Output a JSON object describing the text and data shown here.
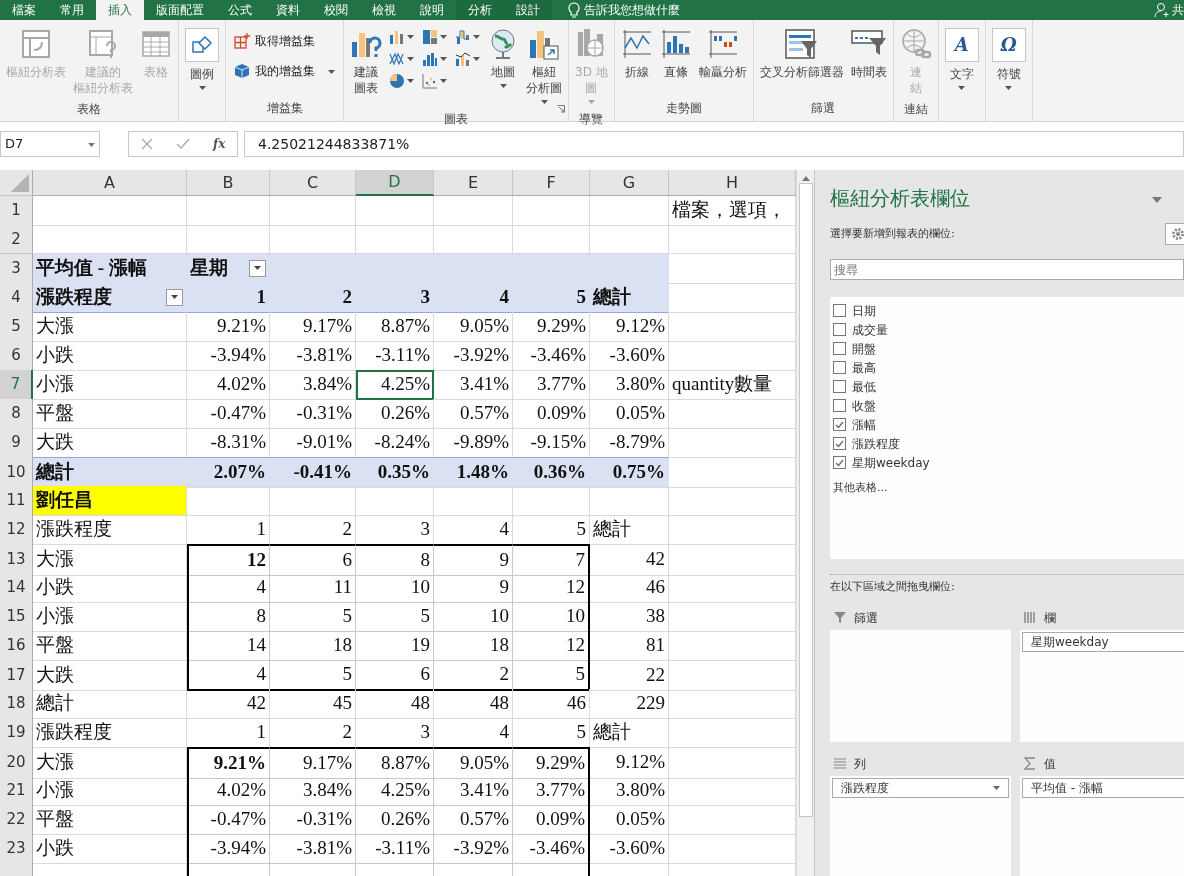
{
  "ribbon_tabs": [
    {
      "label": "檔案",
      "selected": false,
      "kind": "normal"
    },
    {
      "label": "常用",
      "selected": false,
      "kind": "normal"
    },
    {
      "label": "插入",
      "selected": true,
      "kind": "normal"
    },
    {
      "label": "版面配置",
      "selected": false,
      "kind": "normal"
    },
    {
      "label": "公式",
      "selected": false,
      "kind": "normal"
    },
    {
      "label": "資料",
      "selected": false,
      "kind": "normal"
    },
    {
      "label": "校閱",
      "selected": false,
      "kind": "normal"
    },
    {
      "label": "檢視",
      "selected": false,
      "kind": "normal"
    },
    {
      "label": "說明",
      "selected": false,
      "kind": "normal"
    },
    {
      "label": "分析",
      "selected": false,
      "kind": "contextual"
    },
    {
      "label": "設計",
      "selected": false,
      "kind": "contextual"
    }
  ],
  "tell_me": "告訴我您想做什麼",
  "share": "共",
  "ribbon_groups": [
    {
      "label": "表格",
      "items": [
        {
          "kind": "large",
          "lines": [
            "樞紐分析表"
          ],
          "disabled": true,
          "dropdown": false
        },
        {
          "kind": "large",
          "lines": [
            "建議的",
            "樞紐分析表"
          ],
          "disabled": true,
          "dropdown": false
        },
        {
          "kind": "large",
          "lines": [
            "表格"
          ],
          "disabled": true,
          "dropdown": false
        }
      ]
    },
    {
      "items": [
        {
          "kind": "framed",
          "lines": [
            "圖例"
          ],
          "disabled": false,
          "dropdown": true
        }
      ]
    },
    {
      "label": "增益集",
      "items": [
        {
          "kind": "small",
          "lines": [
            "取得增益集"
          ],
          "disabled": false,
          "dropdown": false
        },
        {
          "kind": "small",
          "lines": [
            "我的增益集"
          ],
          "disabled": false,
          "dropdown": true
        }
      ]
    },
    {
      "label": "圖表",
      "launcher": true,
      "items": [
        {
          "kind": "large",
          "lines": [
            "建議",
            "圖表"
          ],
          "disabled": false,
          "dropdown": false
        },
        {
          "kind": "icon-grid"
        },
        {
          "kind": "large",
          "lines": [
            "地圖"
          ],
          "disabled": false,
          "dropdown": true
        },
        {
          "kind": "large",
          "lines": [
            "樞紐",
            "分析圖"
          ],
          "disabled": false,
          "dropdown": true
        }
      ]
    },
    {
      "label": "導覽",
      "items": [
        {
          "kind": "large",
          "lines": [
            "3D 地",
            "圖"
          ],
          "disabled": true,
          "dropdown": true
        }
      ]
    },
    {
      "label": "走勢圖",
      "items": [
        {
          "kind": "large",
          "lines": [
            "折線"
          ],
          "disabled": false,
          "dropdown": false
        },
        {
          "kind": "large",
          "lines": [
            "直條"
          ],
          "disabled": false,
          "dropdown": false
        },
        {
          "kind": "large",
          "lines": [
            "輸贏分析"
          ],
          "disabled": false,
          "dropdown": false
        }
      ]
    },
    {
      "label": "篩選",
      "items": [
        {
          "kind": "large",
          "lines": [
            "交叉分析篩選器"
          ],
          "disabled": false,
          "dropdown": false
        },
        {
          "kind": "large",
          "lines": [
            "時間表"
          ],
          "disabled": false,
          "dropdown": false
        }
      ]
    },
    {
      "label": "連結",
      "items": [
        {
          "kind": "large",
          "lines": [
            "連",
            "結"
          ],
          "disabled": true,
          "dropdown": false
        }
      ]
    },
    {
      "items": [
        {
          "kind": "framed",
          "lines": [
            "文字"
          ],
          "glyph": "A",
          "disabled": false,
          "dropdown": true
        }
      ]
    },
    {
      "items": [
        {
          "kind": "framed",
          "lines": [
            "符號"
          ],
          "glyph": "Ω",
          "disabled": false,
          "dropdown": true
        }
      ]
    }
  ],
  "formula_bar": {
    "name_box": "D7",
    "function_label": "fx",
    "formula": "4.25021244833871%"
  },
  "sheet": {
    "columns": [
      {
        "label": "A",
        "selected": false
      },
      {
        "label": "B",
        "selected": false
      },
      {
        "label": "C",
        "selected": false
      },
      {
        "label": "D",
        "selected": true
      },
      {
        "label": "E",
        "selected": false
      },
      {
        "label": "F",
        "selected": false
      },
      {
        "label": "G",
        "selected": false
      },
      {
        "label": "H",
        "selected": false
      }
    ],
    "rows": [
      {
        "number": "1",
        "selected": false,
        "kind": "plain",
        "cells": [
          null,
          null,
          null,
          null,
          null,
          null,
          null,
          {
            "text": "檔案，選項，",
            "kind": "text"
          }
        ]
      },
      {
        "number": "2",
        "selected": false,
        "kind": "plain",
        "cells": []
      },
      {
        "number": "3",
        "selected": false,
        "kind": "pivot-title",
        "cells": [
          {
            "text": "平均值 - 漲幅",
            "kind": "text"
          },
          {
            "text": "星期",
            "kind": "text",
            "filter": true
          }
        ]
      },
      {
        "number": "4",
        "selected": false,
        "kind": "pivot-header",
        "cells": [
          {
            "text": "漲跌程度",
            "kind": "text",
            "filter": true
          },
          {
            "text": "1",
            "kind": "number"
          },
          {
            "text": "2",
            "kind": "number"
          },
          {
            "text": "3",
            "kind": "number"
          },
          {
            "text": "4",
            "kind": "number"
          },
          {
            "text": "5",
            "kind": "number"
          },
          {
            "text": "總計",
            "kind": "text"
          }
        ]
      },
      {
        "number": "5",
        "selected": false,
        "kind": "plain",
        "cells": [
          {
            "text": "大漲",
            "kind": "text"
          },
          {
            "text": "9.21%",
            "kind": "number"
          },
          {
            "text": "9.17%",
            "kind": "number"
          },
          {
            "text": "8.87%",
            "kind": "number"
          },
          {
            "text": "9.05%",
            "kind": "number"
          },
          {
            "text": "9.29%",
            "kind": "number"
          },
          {
            "text": "9.12%",
            "kind": "number"
          }
        ]
      },
      {
        "number": "6",
        "selected": false,
        "kind": "plain",
        "cells": [
          {
            "text": "小跌",
            "kind": "text"
          },
          {
            "text": "-3.94%",
            "kind": "number"
          },
          {
            "text": "-3.81%",
            "kind": "number"
          },
          {
            "text": "-3.11%",
            "kind": "number"
          },
          {
            "text": "-3.92%",
            "kind": "number"
          },
          {
            "text": "-3.46%",
            "kind": "number"
          },
          {
            "text": "-3.60%",
            "kind": "number"
          }
        ]
      },
      {
        "number": "7",
        "selected": true,
        "kind": "plain",
        "cells": [
          {
            "text": "小漲",
            "kind": "text"
          },
          {
            "text": "4.02%",
            "kind": "number"
          },
          {
            "text": "3.84%",
            "kind": "number"
          },
          {
            "text": "4.25%",
            "kind": "number"
          },
          {
            "text": "3.41%",
            "kind": "number"
          },
          {
            "text": "3.77%",
            "kind": "number"
          },
          {
            "text": "3.80%",
            "kind": "number"
          },
          {
            "text": "quantity數量",
            "kind": "text"
          }
        ]
      },
      {
        "number": "8",
        "selected": false,
        "kind": "plain",
        "cells": [
          {
            "text": "平盤",
            "kind": "text"
          },
          {
            "text": "-0.47%",
            "kind": "number"
          },
          {
            "text": "-0.31%",
            "kind": "number"
          },
          {
            "text": "0.26%",
            "kind": "number"
          },
          {
            "text": "0.57%",
            "kind": "number"
          },
          {
            "text": "0.09%",
            "kind": "number"
          },
          {
            "text": "0.05%",
            "kind": "number"
          }
        ]
      },
      {
        "number": "9",
        "selected": false,
        "kind": "plain",
        "cells": [
          {
            "text": "大跌",
            "kind": "text"
          },
          {
            "text": "-8.31%",
            "kind": "number"
          },
          {
            "text": "-9.01%",
            "kind": "number"
          },
          {
            "text": "-8.24%",
            "kind": "number"
          },
          {
            "text": "-9.89%",
            "kind": "number"
          },
          {
            "text": "-9.15%",
            "kind": "number"
          },
          {
            "text": "-8.79%",
            "kind": "number"
          }
        ]
      },
      {
        "number": "10",
        "selected": false,
        "kind": "pivot-total",
        "cells": [
          {
            "text": "總計",
            "kind": "text"
          },
          {
            "text": "2.07%",
            "kind": "number"
          },
          {
            "text": "-0.41%",
            "kind": "number"
          },
          {
            "text": "0.35%",
            "kind": "number"
          },
          {
            "text": "1.48%",
            "kind": "number"
          },
          {
            "text": "0.36%",
            "kind": "number"
          },
          {
            "text": "0.75%",
            "kind": "number"
          }
        ]
      },
      {
        "number": "11",
        "selected": false,
        "kind": "plain",
        "cells": [
          {
            "text": "劉任昌",
            "kind": "text",
            "bold": true,
            "highlighted": true
          }
        ]
      },
      {
        "number": "12",
        "selected": false,
        "kind": "plain",
        "cells": [
          {
            "text": "漲跌程度",
            "kind": "text"
          },
          {
            "text": "1",
            "kind": "number"
          },
          {
            "text": "2",
            "kind": "number"
          },
          {
            "text": "3",
            "kind": "number"
          },
          {
            "text": "4",
            "kind": "number"
          },
          {
            "text": "5",
            "kind": "number"
          },
          {
            "text": "總計",
            "kind": "text"
          }
        ]
      },
      {
        "number": "13",
        "selected": false,
        "kind": "plain",
        "cells": [
          {
            "text": "大漲",
            "kind": "text"
          },
          {
            "text": "12",
            "kind": "number",
            "bold": true,
            "boxed": true
          },
          {
            "text": "6",
            "kind": "number",
            "boxed": true
          },
          {
            "text": "8",
            "kind": "number",
            "boxed": true
          },
          {
            "text": "9",
            "kind": "number",
            "boxed": true
          },
          {
            "text": "7",
            "kind": "number",
            "boxed": true
          },
          {
            "text": "42",
            "kind": "number"
          }
        ]
      },
      {
        "number": "14",
        "selected": false,
        "kind": "plain",
        "cells": [
          {
            "text": "小跌",
            "kind": "text"
          },
          {
            "text": "4",
            "kind": "number",
            "boxed": true
          },
          {
            "text": "11",
            "kind": "number",
            "boxed": true
          },
          {
            "text": "10",
            "kind": "number",
            "boxed": true
          },
          {
            "text": "9",
            "kind": "number",
            "boxed": true
          },
          {
            "text": "12",
            "kind": "number",
            "boxed": true
          },
          {
            "text": "46",
            "kind": "number"
          }
        ]
      },
      {
        "number": "15",
        "selected": false,
        "kind": "plain",
        "cells": [
          {
            "text": "小漲",
            "kind": "text"
          },
          {
            "text": "8",
            "kind": "number",
            "boxed": true
          },
          {
            "text": "5",
            "kind": "number",
            "boxed": true
          },
          {
            "text": "5",
            "kind": "number",
            "boxed": true
          },
          {
            "text": "10",
            "kind": "number",
            "boxed": true
          },
          {
            "text": "10",
            "kind": "number",
            "boxed": true
          },
          {
            "text": "38",
            "kind": "number"
          }
        ]
      },
      {
        "number": "16",
        "selected": false,
        "kind": "plain",
        "cells": [
          {
            "text": "平盤",
            "kind": "text"
          },
          {
            "text": "14",
            "kind": "number",
            "boxed": true
          },
          {
            "text": "18",
            "kind": "number",
            "boxed": true
          },
          {
            "text": "19",
            "kind": "number",
            "boxed": true
          },
          {
            "text": "18",
            "kind": "number",
            "boxed": true
          },
          {
            "text": "12",
            "kind": "number",
            "boxed": true
          },
          {
            "text": "81",
            "kind": "number"
          }
        ]
      },
      {
        "number": "17",
        "selected": false,
        "kind": "plain",
        "cells": [
          {
            "text": "大跌",
            "kind": "text"
          },
          {
            "text": "4",
            "kind": "number",
            "boxed": true
          },
          {
            "text": "5",
            "kind": "number",
            "boxed": true
          },
          {
            "text": "6",
            "kind": "number",
            "boxed": true
          },
          {
            "text": "2",
            "kind": "number",
            "boxed": true
          },
          {
            "text": "5",
            "kind": "number",
            "boxed": true
          },
          {
            "text": "22",
            "kind": "number"
          }
        ]
      },
      {
        "number": "18",
        "selected": false,
        "kind": "plain",
        "cells": [
          {
            "text": "總計",
            "kind": "text"
          },
          {
            "text": "42",
            "kind": "number"
          },
          {
            "text": "45",
            "kind": "number"
          },
          {
            "text": "48",
            "kind": "number"
          },
          {
            "text": "48",
            "kind": "number"
          },
          {
            "text": "46",
            "kind": "number"
          },
          {
            "text": "229",
            "kind": "number"
          }
        ]
      },
      {
        "number": "19",
        "selected": false,
        "kind": "plain",
        "cells": [
          {
            "text": "漲跌程度",
            "kind": "text"
          },
          {
            "text": "1",
            "kind": "number"
          },
          {
            "text": "2",
            "kind": "number"
          },
          {
            "text": "3",
            "kind": "number"
          },
          {
            "text": "4",
            "kind": "number"
          },
          {
            "text": "5",
            "kind": "number"
          },
          {
            "text": "總計",
            "kind": "text"
          }
        ]
      },
      {
        "number": "20",
        "selected": false,
        "kind": "plain",
        "cells": [
          {
            "text": "大漲",
            "kind": "text"
          },
          {
            "text": "9.21%",
            "kind": "number",
            "bold": true,
            "boxed": true
          },
          {
            "text": "9.17%",
            "kind": "number",
            "boxed": true
          },
          {
            "text": "8.87%",
            "kind": "number",
            "boxed": true
          },
          {
            "text": "9.05%",
            "kind": "number",
            "boxed": true
          },
          {
            "text": "9.29%",
            "kind": "number",
            "boxed": true
          },
          {
            "text": "9.12%",
            "kind": "number"
          }
        ]
      },
      {
        "number": "21",
        "selected": false,
        "kind": "plain",
        "cells": [
          {
            "text": "小漲",
            "kind": "text"
          },
          {
            "text": "4.02%",
            "kind": "number",
            "boxed": true
          },
          {
            "text": "3.84%",
            "kind": "number",
            "boxed": true
          },
          {
            "text": "4.25%",
            "kind": "number",
            "boxed": true
          },
          {
            "text": "3.41%",
            "kind": "number",
            "boxed": true
          },
          {
            "text": "3.77%",
            "kind": "number",
            "boxed": true
          },
          {
            "text": "3.80%",
            "kind": "number"
          }
        ]
      },
      {
        "number": "22",
        "selected": false,
        "kind": "plain",
        "cells": [
          {
            "text": "平盤",
            "kind": "text"
          },
          {
            "text": "-0.47%",
            "kind": "number",
            "boxed": true
          },
          {
            "text": "-0.31%",
            "kind": "number",
            "boxed": true
          },
          {
            "text": "0.26%",
            "kind": "number",
            "boxed": true
          },
          {
            "text": "0.57%",
            "kind": "number",
            "boxed": true
          },
          {
            "text": "0.09%",
            "kind": "number",
            "boxed": true
          },
          {
            "text": "0.05%",
            "kind": "number"
          }
        ]
      },
      {
        "number": "23",
        "selected": false,
        "kind": "plain",
        "cells": [
          {
            "text": "小跌",
            "kind": "text"
          },
          {
            "text": "-3.94%",
            "kind": "number",
            "boxed": true
          },
          {
            "text": "-3.81%",
            "kind": "number",
            "boxed": true
          },
          {
            "text": "-3.11%",
            "kind": "number",
            "boxed": true
          },
          {
            "text": "-3.92%",
            "kind": "number",
            "boxed": true
          },
          {
            "text": "-3.46%",
            "kind": "number",
            "boxed": true
          },
          {
            "text": "-3.60%",
            "kind": "number"
          }
        ]
      },
      {
        "selected": false,
        "kind": "plain",
        "cells": [
          null,
          {
            "boxed": true
          },
          {
            "boxed": true
          },
          {
            "boxed": true
          },
          {
            "boxed": true
          },
          {
            "boxed": true
          }
        ]
      }
    ]
  },
  "pivot_pane": {
    "title": "樞紐分析表欄位",
    "subtitle": "選擇要新增到報表的欄位:",
    "search": {
      "placeholder": "搜尋"
    },
    "fields": [
      {
        "label": "日期",
        "checked": false
      },
      {
        "label": "成交量",
        "checked": false
      },
      {
        "label": "開盤",
        "checked": false
      },
      {
        "label": "最高",
        "checked": false
      },
      {
        "label": "最低",
        "checked": false
      },
      {
        "label": "收盤",
        "checked": false
      },
      {
        "label": "漲幅",
        "checked": true
      },
      {
        "label": "漲跌程度",
        "checked": true
      },
      {
        "label": "星期weekday",
        "checked": true
      }
    ],
    "more_tables": "其他表格...",
    "areas_caption": "在以下區域之間拖曳欄位:",
    "areas": [
      {
        "label": "篩選",
        "kind": "filter"
      },
      {
        "label": "欄",
        "kind": "columns",
        "items": [
          {
            "label": "星期weekday"
          }
        ]
      },
      {
        "label": "列",
        "kind": "rows",
        "items": [
          {
            "label": "漲跌程度"
          }
        ]
      },
      {
        "label": "值",
        "kind": "values",
        "items": [
          {
            "label": "平均值 - 漲幅"
          }
        ]
      }
    ]
  }
}
